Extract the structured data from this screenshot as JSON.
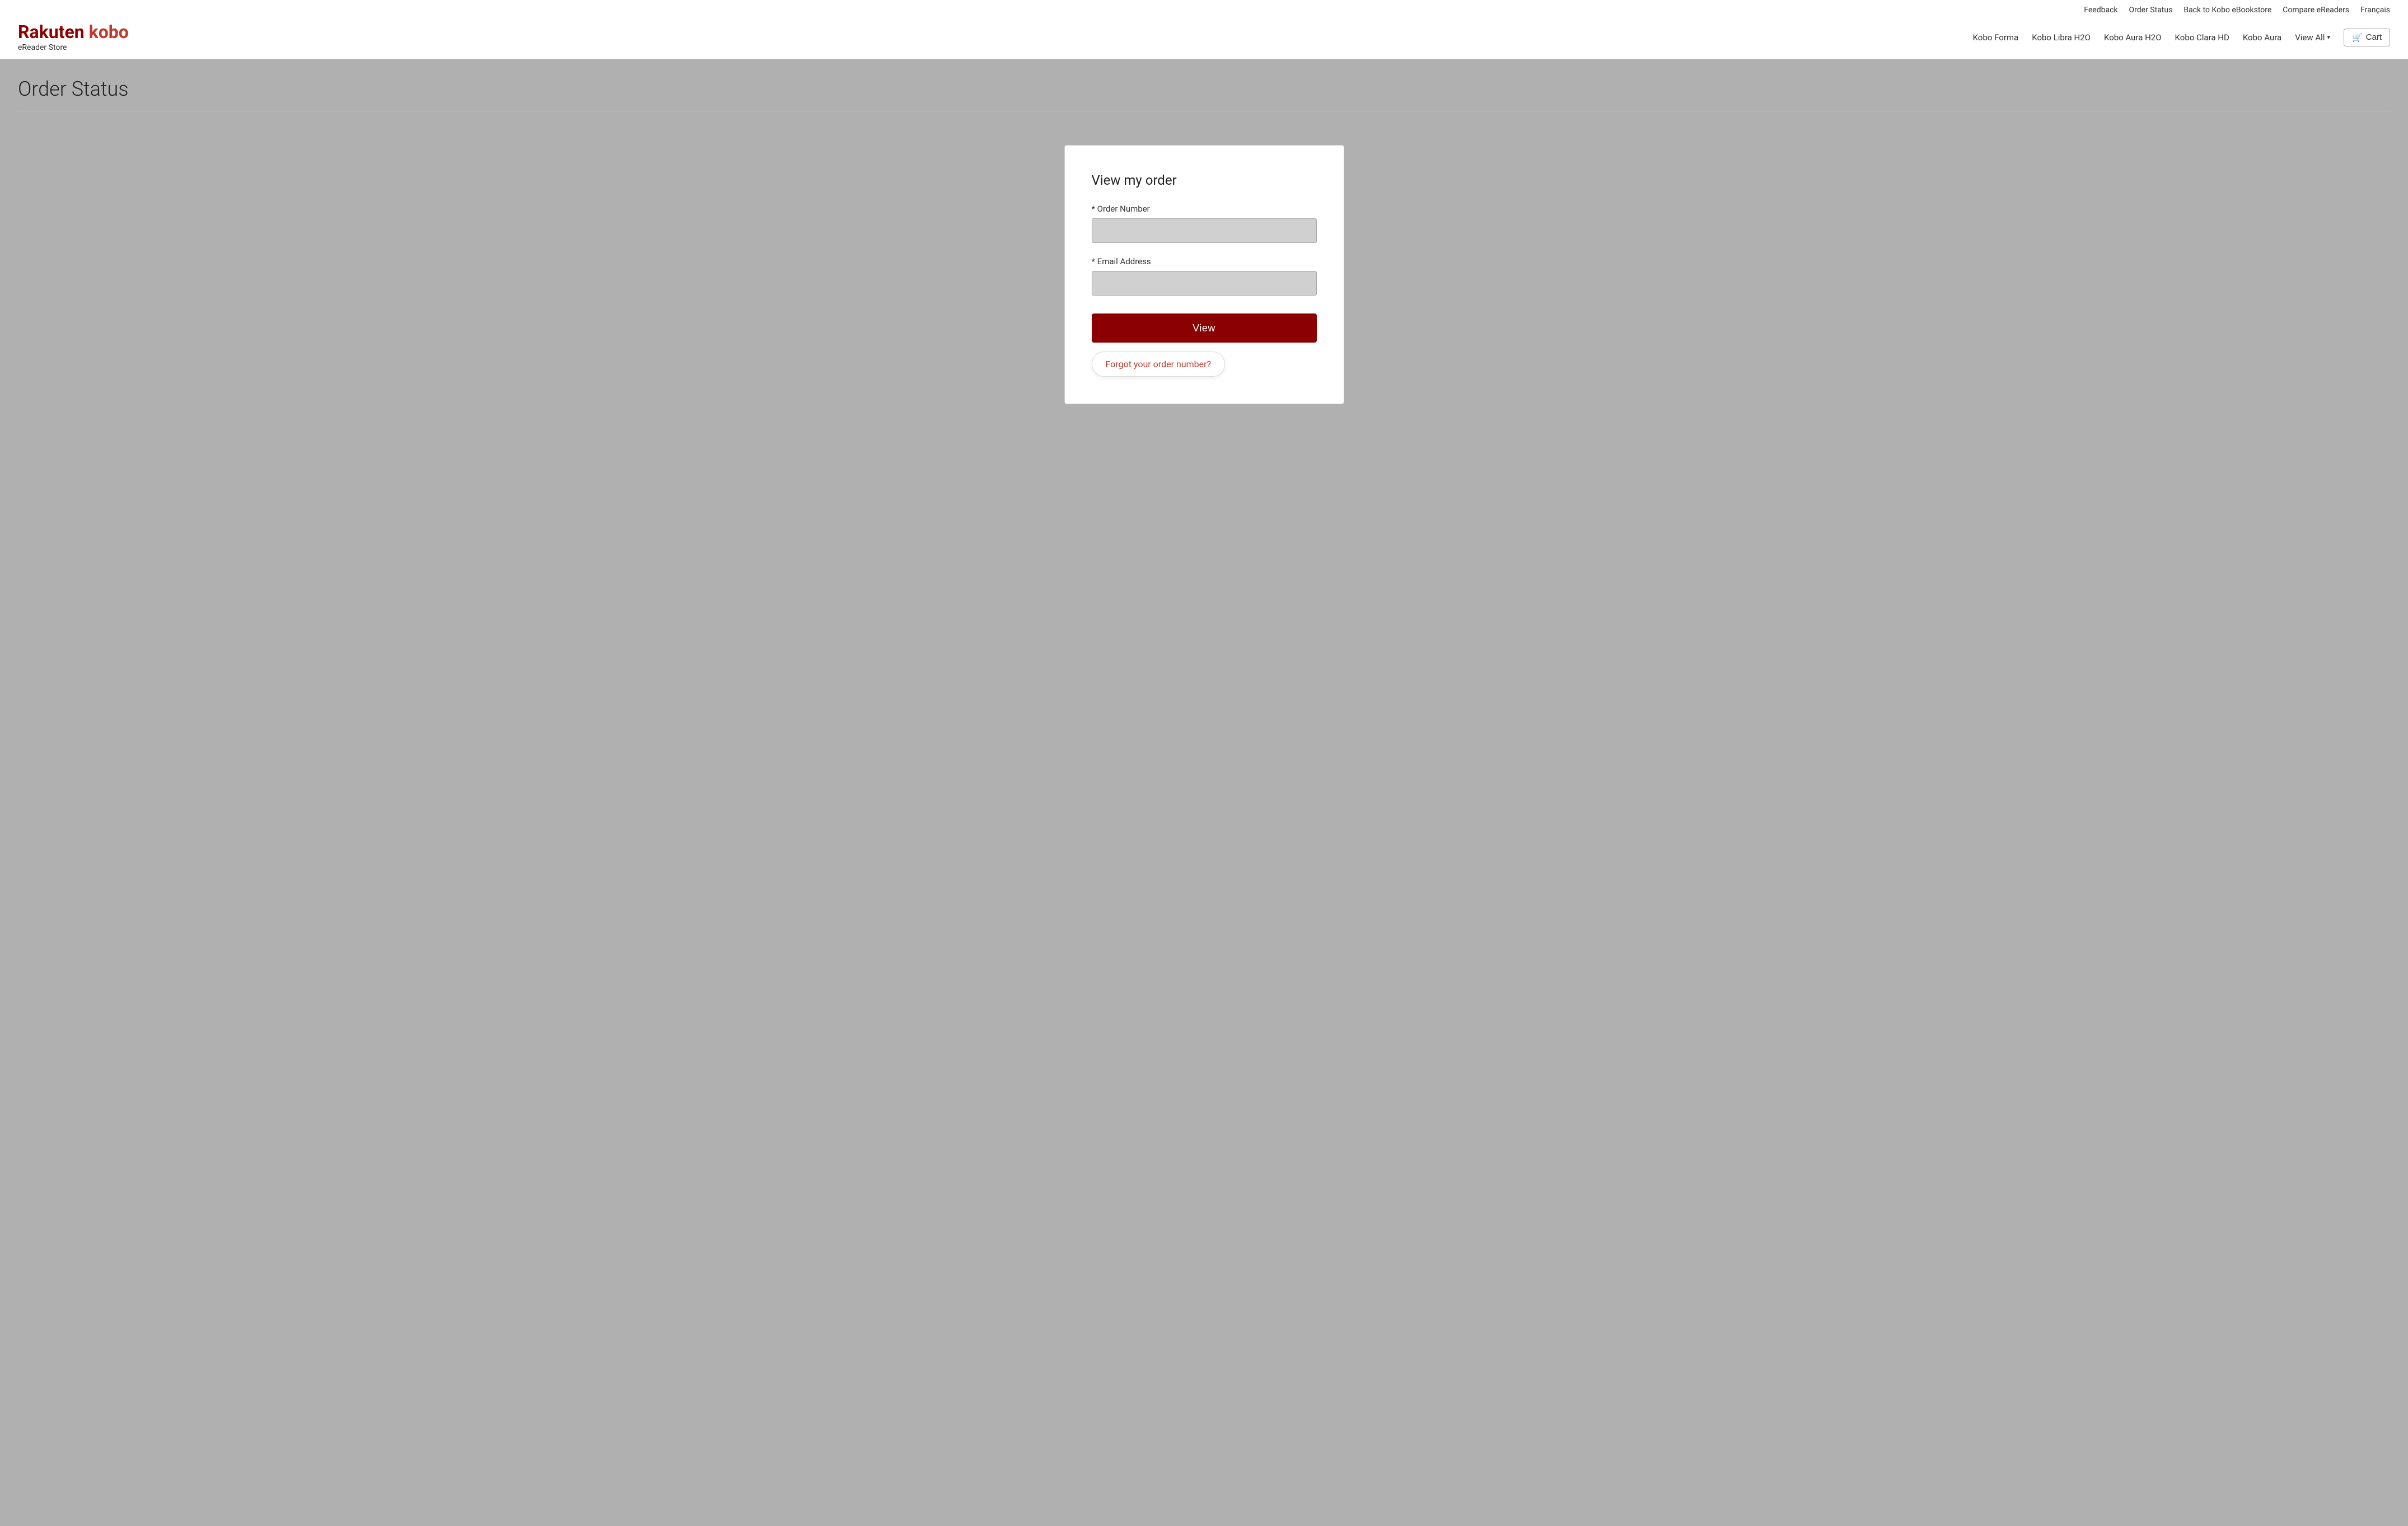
{
  "topNav": {
    "items": [
      {
        "label": "Feedback",
        "name": "feedback-link"
      },
      {
        "label": "Order Status",
        "name": "order-status-link"
      },
      {
        "label": "Back to Kobo eBookstore",
        "name": "back-to-bookstore-link"
      },
      {
        "label": "Compare eReaders",
        "name": "compare-ereaders-link"
      },
      {
        "label": "Français",
        "name": "francais-link"
      }
    ]
  },
  "logo": {
    "rakuten": "Rakuten",
    "kobo": " kobo",
    "sub": "eReader Store"
  },
  "mainNav": {
    "items": [
      {
        "label": "Kobo Forma",
        "name": "nav-kobo-forma"
      },
      {
        "label": "Kobo Libra H2O",
        "name": "nav-kobo-libra"
      },
      {
        "label": "Kobo Aura H2O",
        "name": "nav-kobo-aura-h2o"
      },
      {
        "label": "Kobo Clara HD",
        "name": "nav-kobo-clara"
      },
      {
        "label": "Kobo Aura",
        "name": "nav-kobo-aura"
      },
      {
        "label": "View All",
        "name": "nav-view-all"
      }
    ],
    "cart": "Cart"
  },
  "page": {
    "title": "Order Status"
  },
  "form": {
    "title": "View my order",
    "orderNumberLabel": "* Order Number",
    "orderNumberPlaceholder": "",
    "emailLabel": "* Email Address",
    "emailPlaceholder": "",
    "viewButton": "View",
    "forgotLink": "Forgot your order number?"
  }
}
